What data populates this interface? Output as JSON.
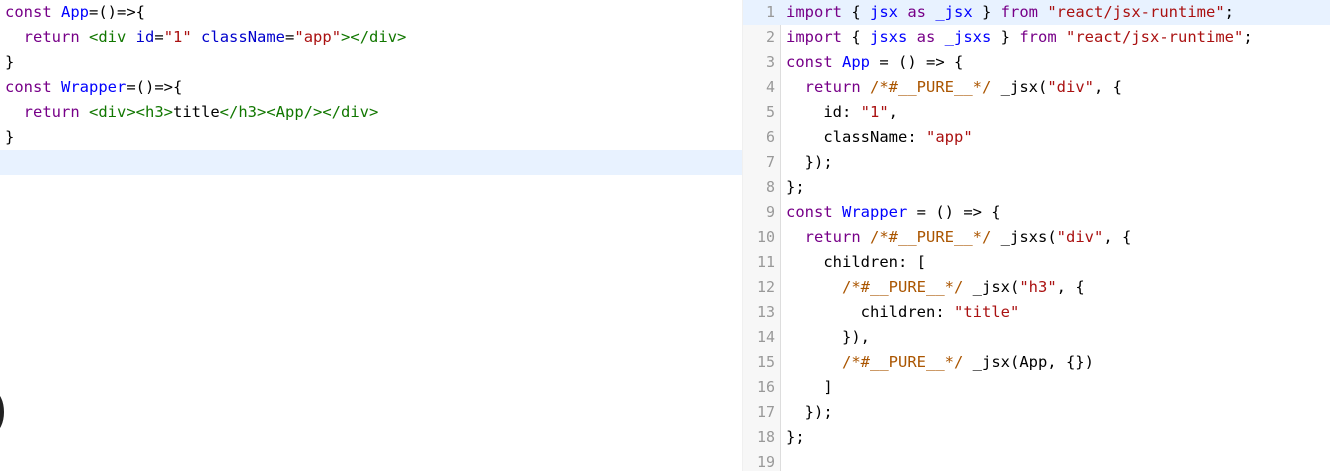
{
  "left_editor": {
    "lines": [
      [
        {
          "t": "const ",
          "c": "kw2"
        },
        {
          "t": "App",
          "c": "vdef"
        },
        {
          "t": "=()=>{",
          "c": "pn"
        }
      ],
      [
        {
          "t": "  ",
          "c": "pn"
        },
        {
          "t": "return ",
          "c": "kw2"
        },
        {
          "t": "<div ",
          "c": "tag"
        },
        {
          "t": "id",
          "c": "attr"
        },
        {
          "t": "=",
          "c": "pn"
        },
        {
          "t": "\"1\"",
          "c": "str"
        },
        {
          "t": " ",
          "c": "pn"
        },
        {
          "t": "className",
          "c": "attr"
        },
        {
          "t": "=",
          "c": "pn"
        },
        {
          "t": "\"app\"",
          "c": "str"
        },
        {
          "t": "></div>",
          "c": "tag"
        }
      ],
      [
        {
          "t": "}",
          "c": "pn"
        }
      ],
      [
        {
          "t": "const ",
          "c": "kw2"
        },
        {
          "t": "Wrapper",
          "c": "vdef"
        },
        {
          "t": "=()=>{",
          "c": "pn"
        }
      ],
      [
        {
          "t": "  ",
          "c": "pn"
        },
        {
          "t": "return ",
          "c": "kw2"
        },
        {
          "t": "<div><h3>",
          "c": "tag"
        },
        {
          "t": "title",
          "c": "pn"
        },
        {
          "t": "</h3><App/></div>",
          "c": "tag"
        }
      ],
      [
        {
          "t": "}",
          "c": "pn"
        }
      ],
      [
        {
          "t": "",
          "c": "pn"
        }
      ]
    ],
    "active_line": 6
  },
  "right_editor": {
    "lines": [
      [
        {
          "t": "import ",
          "c": "kw2"
        },
        {
          "t": "{ ",
          "c": "pn"
        },
        {
          "t": "jsx ",
          "c": "def"
        },
        {
          "t": "as ",
          "c": "kw2"
        },
        {
          "t": "_jsx ",
          "c": "def"
        },
        {
          "t": "} ",
          "c": "pn"
        },
        {
          "t": "from ",
          "c": "kw2"
        },
        {
          "t": "\"react/jsx-runtime\"",
          "c": "str"
        },
        {
          "t": ";",
          "c": "pn"
        }
      ],
      [
        {
          "t": "import ",
          "c": "kw2"
        },
        {
          "t": "{ ",
          "c": "pn"
        },
        {
          "t": "jsxs ",
          "c": "def"
        },
        {
          "t": "as ",
          "c": "kw2"
        },
        {
          "t": "_jsxs ",
          "c": "def"
        },
        {
          "t": "} ",
          "c": "pn"
        },
        {
          "t": "from ",
          "c": "kw2"
        },
        {
          "t": "\"react/jsx-runtime\"",
          "c": "str"
        },
        {
          "t": ";",
          "c": "pn"
        }
      ],
      [
        {
          "t": "const ",
          "c": "kw2"
        },
        {
          "t": "App ",
          "c": "vdef"
        },
        {
          "t": "= () => {",
          "c": "pn"
        }
      ],
      [
        {
          "t": "  ",
          "c": "pn"
        },
        {
          "t": "return ",
          "c": "kw2"
        },
        {
          "t": "/*#__PURE__*/ ",
          "c": "cm"
        },
        {
          "t": "_jsx(",
          "c": "pn"
        },
        {
          "t": "\"div\"",
          "c": "str"
        },
        {
          "t": ", {",
          "c": "pn"
        }
      ],
      [
        {
          "t": "    ",
          "c": "pn"
        },
        {
          "t": "id",
          "c": "prop"
        },
        {
          "t": ": ",
          "c": "pn"
        },
        {
          "t": "\"1\"",
          "c": "str"
        },
        {
          "t": ",",
          "c": "pn"
        }
      ],
      [
        {
          "t": "    ",
          "c": "pn"
        },
        {
          "t": "className",
          "c": "prop"
        },
        {
          "t": ": ",
          "c": "pn"
        },
        {
          "t": "\"app\"",
          "c": "str"
        }
      ],
      [
        {
          "t": "  });",
          "c": "pn"
        }
      ],
      [
        {
          "t": "};",
          "c": "pn"
        }
      ],
      [
        {
          "t": "const ",
          "c": "kw2"
        },
        {
          "t": "Wrapper ",
          "c": "vdef"
        },
        {
          "t": "= () => {",
          "c": "pn"
        }
      ],
      [
        {
          "t": "  ",
          "c": "pn"
        },
        {
          "t": "return ",
          "c": "kw2"
        },
        {
          "t": "/*#__PURE__*/ ",
          "c": "cm"
        },
        {
          "t": "_jsxs(",
          "c": "pn"
        },
        {
          "t": "\"div\"",
          "c": "str"
        },
        {
          "t": ", {",
          "c": "pn"
        }
      ],
      [
        {
          "t": "    ",
          "c": "pn"
        },
        {
          "t": "children",
          "c": "prop"
        },
        {
          "t": ": [",
          "c": "pn"
        }
      ],
      [
        {
          "t": "      ",
          "c": "pn"
        },
        {
          "t": "/*#__PURE__*/ ",
          "c": "cm"
        },
        {
          "t": "_jsx(",
          "c": "pn"
        },
        {
          "t": "\"h3\"",
          "c": "str"
        },
        {
          "t": ", {",
          "c": "pn"
        }
      ],
      [
        {
          "t": "        ",
          "c": "pn"
        },
        {
          "t": "children",
          "c": "prop"
        },
        {
          "t": ": ",
          "c": "pn"
        },
        {
          "t": "\"title\"",
          "c": "str"
        }
      ],
      [
        {
          "t": "      }),",
          "c": "pn"
        }
      ],
      [
        {
          "t": "      ",
          "c": "pn"
        },
        {
          "t": "/*#__PURE__*/ ",
          "c": "cm"
        },
        {
          "t": "_jsx(App, {})",
          "c": "pn"
        }
      ],
      [
        {
          "t": "    ]",
          "c": "pn"
        }
      ],
      [
        {
          "t": "  });",
          "c": "pn"
        }
      ],
      [
        {
          "t": "};",
          "c": "pn"
        }
      ],
      [
        {
          "t": "",
          "c": "pn"
        }
      ]
    ],
    "line_numbers": [
      "1",
      "2",
      "3",
      "4",
      "5",
      "6",
      "7",
      "8",
      "9",
      "10",
      "11",
      "12",
      "13",
      "14",
      "15",
      "16",
      "17",
      "18",
      "19"
    ],
    "active_line": 0
  }
}
